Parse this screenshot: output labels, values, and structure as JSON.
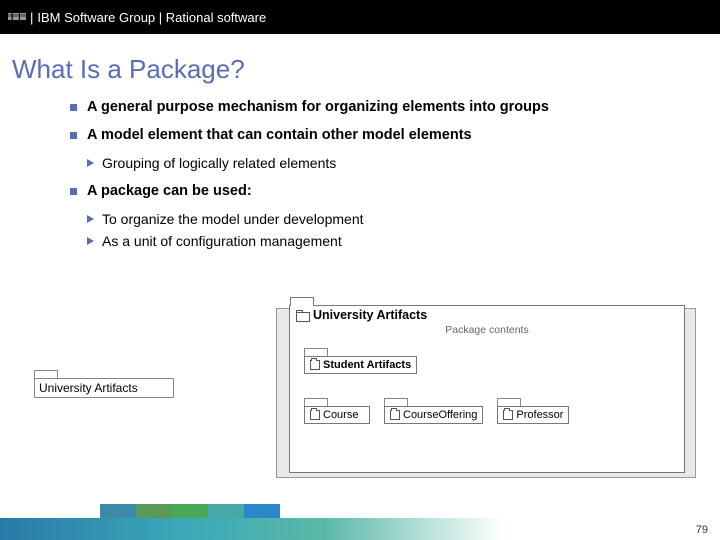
{
  "header": {
    "brand": "IBM",
    "text": "IBM Software Group | Rational software"
  },
  "title": "What Is a Package?",
  "bullets": [
    {
      "text": "A general purpose mechanism for organizing elements into groups",
      "sub": []
    },
    {
      "text": "A model element that can contain other model elements",
      "sub": [
        "Grouping of logically related elements"
      ]
    },
    {
      "text": "A package can be used:",
      "sub": [
        "To organize the model under development",
        "As a unit of configuration management"
      ]
    }
  ],
  "diagram": {
    "simple_package": "University Artifacts",
    "big_package_title": "University Artifacts",
    "big_package_subtitle": "Package contents",
    "student_package": "Student Artifacts",
    "inner_packages": [
      "Course",
      "CourseOffering",
      "Professor"
    ]
  },
  "page_number": "79"
}
